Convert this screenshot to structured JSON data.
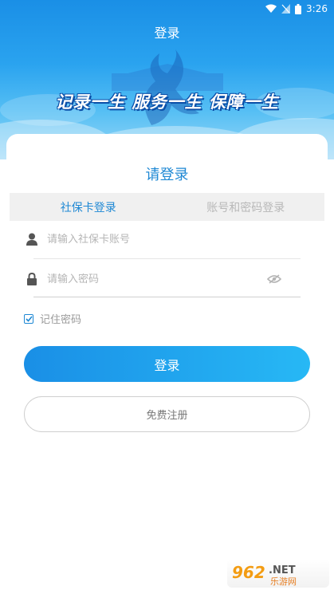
{
  "status_bar": {
    "time": "3:26"
  },
  "header": {
    "title": "登录",
    "slogan": "记录一生 服务一生 保障一生"
  },
  "card": {
    "title": "请登录",
    "tabs": [
      {
        "label": "社保卡登录",
        "active": true
      },
      {
        "label": "账号和密码登录",
        "active": false
      }
    ],
    "account": {
      "placeholder": "请输入社保卡账号",
      "value": ""
    },
    "password": {
      "placeholder": "请输入密码",
      "value": ""
    },
    "remember": {
      "label": "记住密码",
      "checked": true
    },
    "login_label": "登录",
    "register_label": "免费注册"
  },
  "watermark": {
    "text": "962.NET",
    "sub": "乐游网"
  },
  "colors": {
    "accent": "#1e88d4",
    "header_top": "#1a8fe6",
    "button_end": "#27b8f5"
  }
}
